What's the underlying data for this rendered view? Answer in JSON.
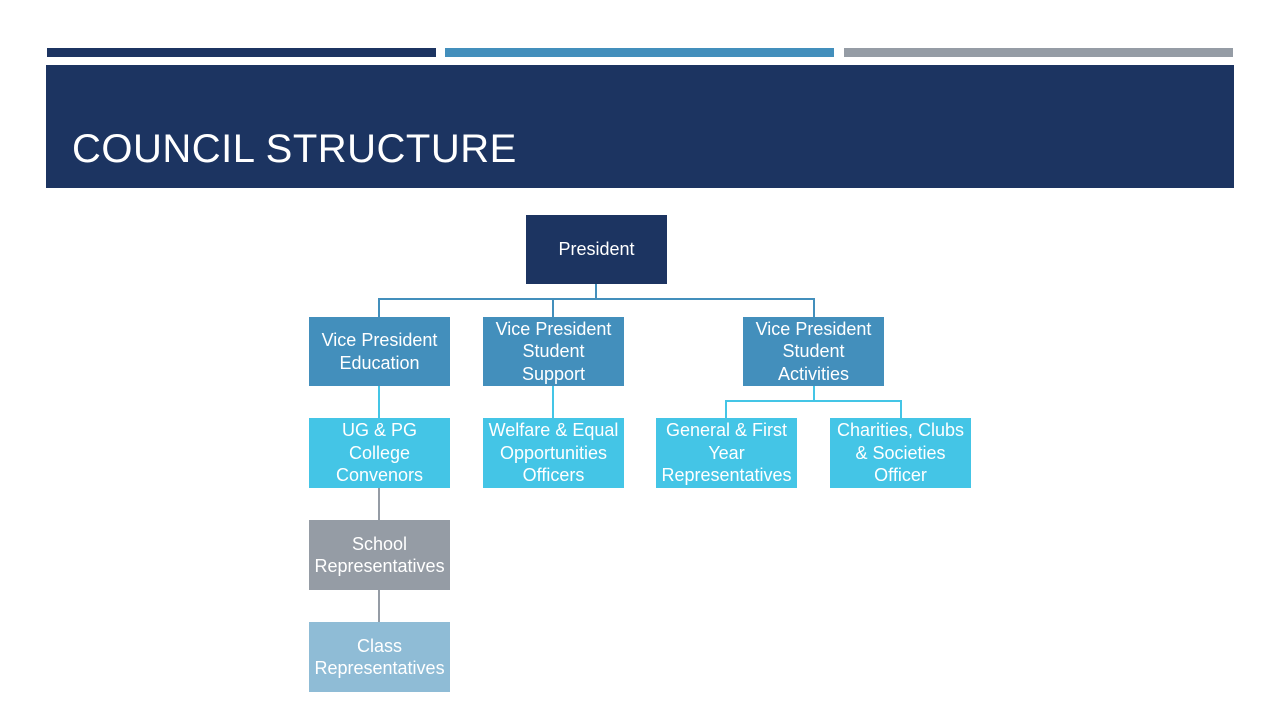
{
  "slide": {
    "title": "COUNCIL STRUCTURE",
    "accent_bars": [
      {
        "name": "navy",
        "color": "#1c3461"
      },
      {
        "name": "steel-blue",
        "color": "#438fbc"
      },
      {
        "name": "gray",
        "color": "#959ca5"
      }
    ],
    "header_color": "#1c3461"
  },
  "org_chart": {
    "colors": {
      "president": "#1c3461",
      "vice_president": "#438fbc",
      "officer": "#44c5e6",
      "school": "#959ca5",
      "class": "#8fbcd6",
      "connector_top": "#438fbc",
      "connector_officer": "#44c5e6",
      "connector_gray": "#959ca5"
    },
    "president": {
      "label": "President"
    },
    "vice_presidents": [
      {
        "label": "Vice President Education"
      },
      {
        "label": "Vice President Student Support"
      },
      {
        "label": "Vice President Student Activities"
      }
    ],
    "officers": [
      {
        "label": "UG & PG College Convenors",
        "reports_to": "Vice President Education"
      },
      {
        "label": "Welfare & Equal Opportunities Officers",
        "reports_to": "Vice President Student Support"
      },
      {
        "label": "General & First Year Representatives",
        "reports_to": "Vice President Student Activities"
      },
      {
        "label": "Charities, Clubs & Societies Officer",
        "reports_to": "Vice President Student Activities"
      }
    ],
    "school_reps": {
      "label": "School Representatives",
      "reports_to": "UG & PG College Convenors"
    },
    "class_reps": {
      "label": "Class Representatives",
      "reports_to": "School Representatives"
    }
  }
}
